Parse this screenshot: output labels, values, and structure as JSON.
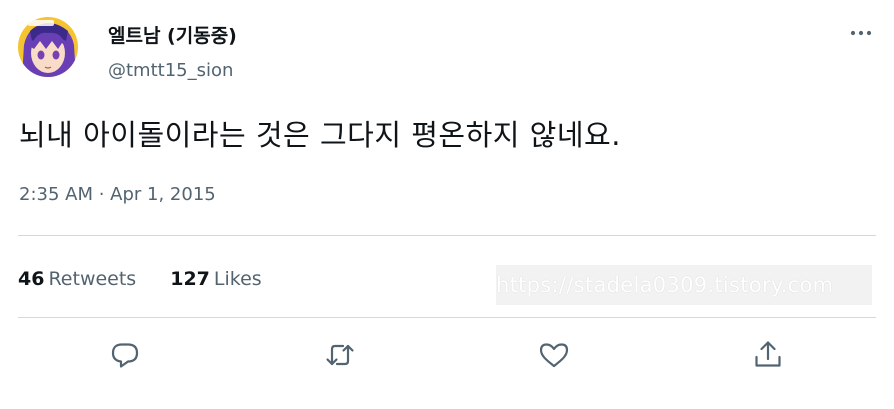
{
  "author": {
    "display_name": "엘트남 (기동중)",
    "handle": "@tmtt15_sion",
    "avatar_icon": "anime-avatar"
  },
  "tweet": {
    "text": "뇌내 아이돌이라는 것은 그다지 평온하지 않네요.",
    "timestamp": "2:35 AM · Apr 1, 2015"
  },
  "stats": {
    "retweets_count": "46",
    "retweets_label": "Retweets",
    "likes_count": "127",
    "likes_label": "Likes"
  },
  "watermark": {
    "text": "https://stadela0309.tistory.com"
  },
  "actions": {
    "reply_icon": "reply-icon",
    "retweet_icon": "retweet-icon",
    "like_icon": "heart-icon",
    "share_icon": "share-icon"
  },
  "colors": {
    "text": "#0f1419",
    "secondary": "#536471",
    "divider": "#cfd9de"
  }
}
